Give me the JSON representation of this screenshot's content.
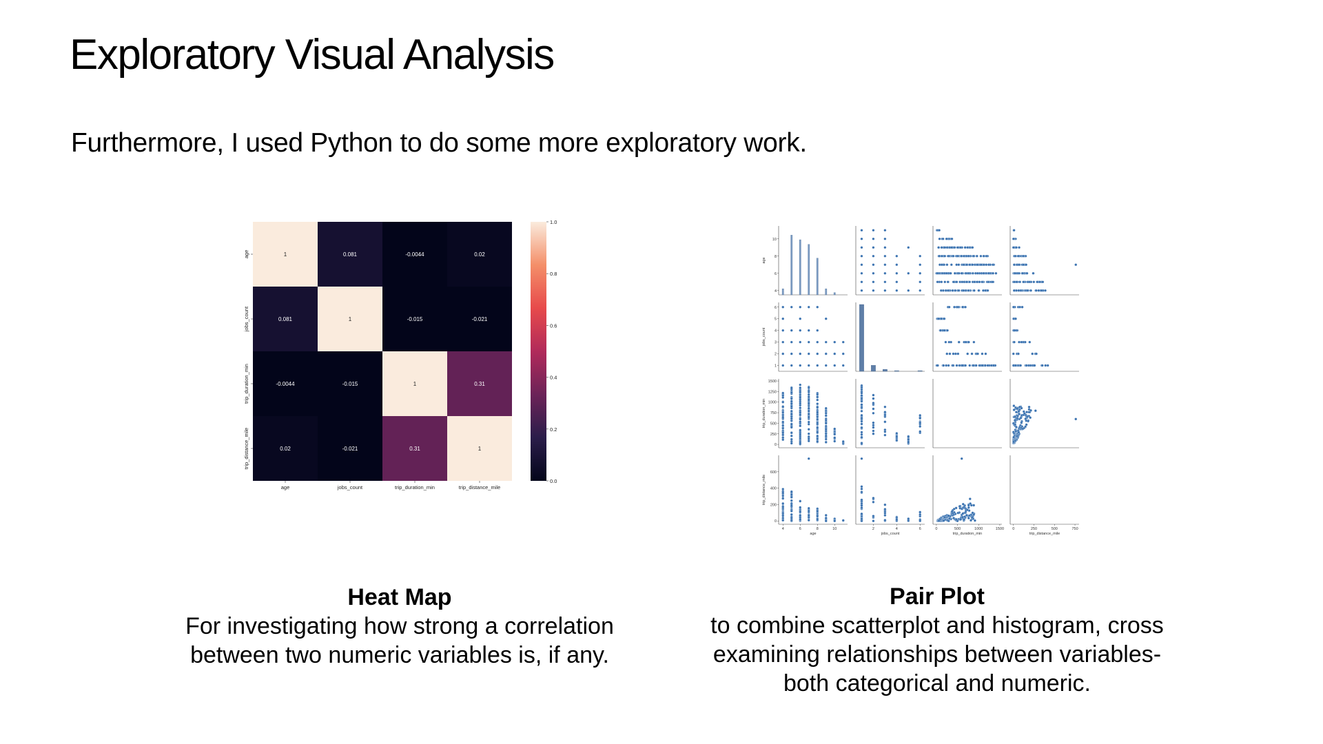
{
  "slide": {
    "title": "Exploratory Visual Analysis",
    "intro": "Furthermore, I used Python to do some more exploratory work."
  },
  "captions": {
    "heatmap": {
      "title": "Heat Map",
      "lines": [
        "For investigating how strong a correlation",
        "between two numeric variables is, if any."
      ]
    },
    "pairplot": {
      "title": "Pair Plot",
      "lines": [
        "to combine scatterplot and histogram, cross",
        "examining relationships between variables-",
        "both categorical and numeric."
      ]
    }
  },
  "chart_data": [
    {
      "type": "heatmap",
      "rows": [
        "age",
        "jobs_count",
        "trip_duration_min",
        "trip_distance_mile"
      ],
      "cols": [
        "age",
        "jobs_count",
        "trip_duration_min",
        "trip_distance_mile"
      ],
      "values": [
        [
          1,
          0.081,
          -0.0044,
          0.02
        ],
        [
          0.081,
          1,
          -0.015,
          -0.021
        ],
        [
          -0.0044,
          -0.015,
          1,
          0.31
        ],
        [
          0.02,
          -0.021,
          0.31,
          1
        ]
      ],
      "labels": [
        [
          "1",
          "0.081",
          "-0.0044",
          "0.02"
        ],
        [
          "0.081",
          "1",
          "-0.015",
          "-0.021"
        ],
        [
          "-0.0044",
          "-0.015",
          "1",
          "0.31"
        ],
        [
          "0.02",
          "-0.021",
          "0.31",
          "1"
        ]
      ],
      "colorbar": {
        "range": [
          0.0,
          1.0
        ],
        "ticks": [
          "0.0",
          "0.2",
          "0.4",
          "0.6",
          "0.8",
          "1.0"
        ],
        "tick_values": [
          0,
          0.2,
          0.4,
          0.6,
          0.8,
          1.0
        ],
        "colormap_stops": [
          "#03051a",
          "#2b1d4a",
          "#6c2358",
          "#b12a5a",
          "#e74a4b",
          "#f48f69",
          "#faebdd"
        ]
      }
    },
    {
      "type": "scatter",
      "subtype": "pairplot",
      "variables": [
        "age",
        "jobs_count",
        "trip_duration_min",
        "trip_distance_mile"
      ],
      "point_color": "#3a72b0",
      "ranges": [
        [
          3.5,
          11.5
        ],
        [
          0.5,
          6.4
        ],
        [
          -80,
          1550
        ],
        [
          -40,
          800
        ]
      ],
      "ticks": {
        "age": [
          4,
          6,
          8,
          10
        ],
        "jobs_count": [
          1,
          2,
          3,
          4,
          5,
          6
        ],
        "jobs_count_x": [
          2,
          4,
          6
        ],
        "trip_duration_min": [
          0,
          250,
          500,
          750,
          1000,
          1250,
          1500
        ],
        "trip_duration_min_x": [
          0,
          500,
          1000,
          1500
        ],
        "trip_distance_mile": [
          0,
          200,
          400,
          600
        ],
        "trip_distance_mile_x": [
          0,
          250,
          500,
          750
        ]
      },
      "age_histogram": [
        {
          "age": 4,
          "height": 0.4
        },
        {
          "age": 5,
          "height": 3.9
        },
        {
          "age": 6,
          "height": 3.6
        },
        {
          "age": 7,
          "height": 3.3
        },
        {
          "age": 8,
          "height": 2.4
        },
        {
          "age": 9,
          "height": 0.4
        },
        {
          "age": 10,
          "height": 0.15
        }
      ],
      "jobs_histogram": [
        {
          "jobs": 1,
          "height": 1
        },
        {
          "jobs": 2,
          "height": 0.09
        },
        {
          "jobs": 3,
          "height": 0.03
        },
        {
          "jobs": 4,
          "height": 0.01
        },
        {
          "jobs": 6,
          "height": 0.01
        }
      ],
      "age_jobs_points": [
        [
          4,
          1
        ],
        [
          5,
          1
        ],
        [
          6,
          1
        ],
        [
          7,
          1
        ],
        [
          8,
          1
        ],
        [
          9,
          1
        ],
        [
          10,
          1
        ],
        [
          11,
          1
        ],
        [
          4,
          2
        ],
        [
          5,
          2
        ],
        [
          6,
          2
        ],
        [
          7,
          2
        ],
        [
          8,
          2
        ],
        [
          9,
          2
        ],
        [
          10,
          2
        ],
        [
          11,
          2
        ],
        [
          4,
          3
        ],
        [
          5,
          3
        ],
        [
          6,
          3
        ],
        [
          7,
          3
        ],
        [
          8,
          3
        ],
        [
          9,
          3
        ],
        [
          10,
          3
        ],
        [
          11,
          3
        ],
        [
          4,
          4
        ],
        [
          5,
          4
        ],
        [
          6,
          4
        ],
        [
          7,
          4
        ],
        [
          8,
          4
        ],
        [
          4,
          5
        ],
        [
          6,
          5
        ],
        [
          9,
          5
        ],
        [
          4,
          6
        ],
        [
          5,
          6
        ],
        [
          6,
          6
        ],
        [
          7,
          6
        ],
        [
          8,
          6
        ]
      ],
      "age_duration_ranges": [
        {
          "age": 4,
          "max": 1230
        },
        {
          "age": 5,
          "max": 1380
        },
        {
          "age": 6,
          "max": 1420
        },
        {
          "age": 7,
          "max": 1370
        },
        {
          "age": 8,
          "max": 1220
        },
        {
          "age": 9,
          "max": 880
        },
        {
          "age": 10,
          "max": 380
        },
        {
          "age": 11,
          "max": 80
        }
      ],
      "age_distance_ranges": [
        {
          "age": 4,
          "max": 400
        },
        {
          "age": 5,
          "max": 360
        },
        {
          "age": 6,
          "max": 260
        },
        {
          "age": 7,
          "max": 180
        },
        {
          "age": 8,
          "max": 180
        },
        {
          "age": 9,
          "max": 100
        },
        {
          "age": 10,
          "max": 40
        },
        {
          "age": 11,
          "max": 15
        }
      ],
      "outlier": {
        "age": 7,
        "jobs_count": 1,
        "trip_duration_min": 600,
        "trip_distance_mile": 760
      }
    }
  ]
}
